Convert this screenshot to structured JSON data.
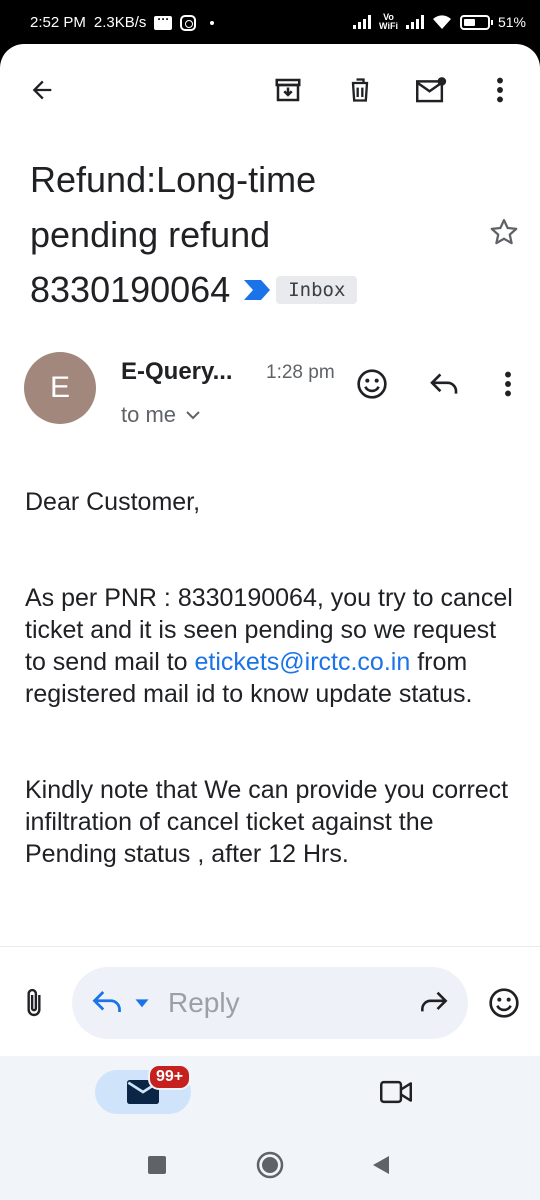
{
  "status_bar": {
    "time": "2:52 PM",
    "speed": "2.3KB/s",
    "vowifi_top": "Vo",
    "vowifi_bottom": "WiFi",
    "battery": "51%"
  },
  "toolbar": {
    "icons": [
      "back-arrow-icon",
      "archive-icon",
      "delete-icon",
      "mark-unread-icon",
      "more-vert-icon"
    ]
  },
  "subject": {
    "line1": "Refund:Long-time",
    "line2": "pending refund",
    "number": "8330190064",
    "label": "Inbox"
  },
  "sender": {
    "initial": "E",
    "name": "E-Query...",
    "time": "1:28 pm",
    "recipient": "to me",
    "avatar_color": "#a2877c"
  },
  "body": {
    "greeting": "Dear Customer,",
    "para1_before": "As per PNR : 8330190064, you try to cancel ticket and it is seen pending so we request to send mail to ",
    "para1_link": "etickets@irctc.co.in",
    "para1_after": " from registered mail id to know update status.",
    "para2": "Kindly note that We can provide you correct infiltration of cancel ticket against the Pending status , after 12 Hrs."
  },
  "reply_bar": {
    "placeholder": "Reply"
  },
  "bottom_nav": {
    "badge": "99+"
  },
  "colors": {
    "accent": "#1a73e8",
    "badge": "#c5221f",
    "important_marker": "#1a73e8"
  }
}
